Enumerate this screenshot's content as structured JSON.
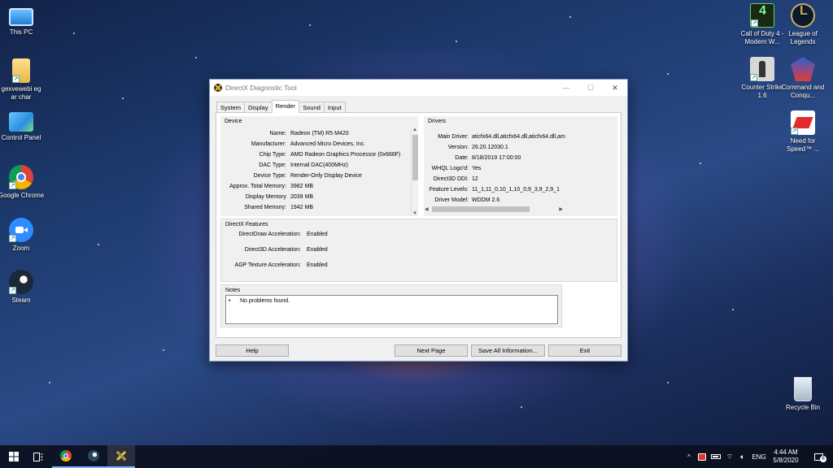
{
  "desktop": {
    "icons_left": [
      {
        "label": "This PC",
        "icon": "this-pc-icon"
      },
      {
        "label": "gexvewebi eg ar char",
        "icon": "folder-icon"
      },
      {
        "label": "Control Panel",
        "icon": "control-panel-icon"
      },
      {
        "label": "Google Chrome",
        "icon": "chrome-icon"
      },
      {
        "label": "Zoom",
        "icon": "zoom-icon"
      },
      {
        "label": "Steam",
        "icon": "steam-icon"
      }
    ],
    "icons_right": [
      {
        "label": "Call of Duty 4 - Modern W...",
        "icon": "cod4-icon"
      },
      {
        "label": "League of Legends",
        "icon": "league-icon"
      },
      {
        "label": "Counter Strike 1.6",
        "icon": "counter-strike-icon"
      },
      {
        "label": "Command and Conqu...",
        "icon": "command-conquer-icon"
      },
      {
        "label": "Need for Speed™ ...",
        "icon": "need-for-speed-icon"
      },
      {
        "label": "Recycle Bin",
        "icon": "recycle-bin-icon"
      }
    ]
  },
  "window": {
    "title": "DirectX Diagnostic Tool",
    "controls": {
      "minimize": "—",
      "maximize": "☐",
      "close": "✕"
    },
    "tabs": [
      "System",
      "Display",
      "Render",
      "Sound",
      "Input"
    ],
    "active_tab": "Render",
    "device": {
      "title": "Device",
      "rows": [
        {
          "k": "Name:",
          "v": "Radeon (TM) R5 M420"
        },
        {
          "k": "Manufacturer:",
          "v": "Advanced Micro Devices, Inc."
        },
        {
          "k": "Chip Type:",
          "v": "AMD Radeon Graphics Processor (0x666F)"
        },
        {
          "k": "DAC Type:",
          "v": "Internal DAC(400MHz)"
        },
        {
          "k": "Device Type:",
          "v": "Render-Only Display Device"
        },
        {
          "k": "Approx. Total Memory:",
          "v": "3982 MB"
        },
        {
          "k": "Display Memory",
          "v": "2039 MB"
        },
        {
          "k": "Shared Memory:",
          "v": "1942 MB"
        }
      ]
    },
    "drivers": {
      "title": "Drivers",
      "rows": [
        {
          "k": "Main Driver:",
          "v": "aticfx64.dll,aticfx64.dll,aticfx64.dll,am"
        },
        {
          "k": "Version:",
          "v": "26.20.12030.1"
        },
        {
          "k": "Date:",
          "v": "8/18/2019 17:00:00"
        },
        {
          "k": "WHQL Logo'd:",
          "v": "Yes"
        },
        {
          "k": "Direct3D DDI:",
          "v": "12"
        },
        {
          "k": "Feature Levels:",
          "v": "11_1,11_0,10_1,10_0,9_3,9_2,9_1"
        },
        {
          "k": "Driver Model:",
          "v": "WDDM 2.6"
        }
      ]
    },
    "features": {
      "title": "DirectX Features",
      "rows": [
        {
          "k": "DirectDraw Acceleration:",
          "v": "Enabled"
        },
        {
          "k": "Direct3D Acceleration:",
          "v": "Enabled"
        },
        {
          "k": "AGP Texture Acceleration:",
          "v": "Enabled"
        }
      ]
    },
    "notes": {
      "title": "Notes",
      "items": [
        "No problems found."
      ]
    },
    "buttons": {
      "help": "Help",
      "next_page": "Next Page",
      "save_all": "Save All Information...",
      "exit": "Exit"
    }
  },
  "taskbar": {
    "pinned": [
      "start-icon",
      "task-view-icon",
      "chrome-icon",
      "steam-icon",
      "dxdiag-icon"
    ],
    "tray": {
      "language": "ENG",
      "time": "4:44 AM",
      "date": "5/8/2020",
      "notification_count": "6"
    }
  }
}
